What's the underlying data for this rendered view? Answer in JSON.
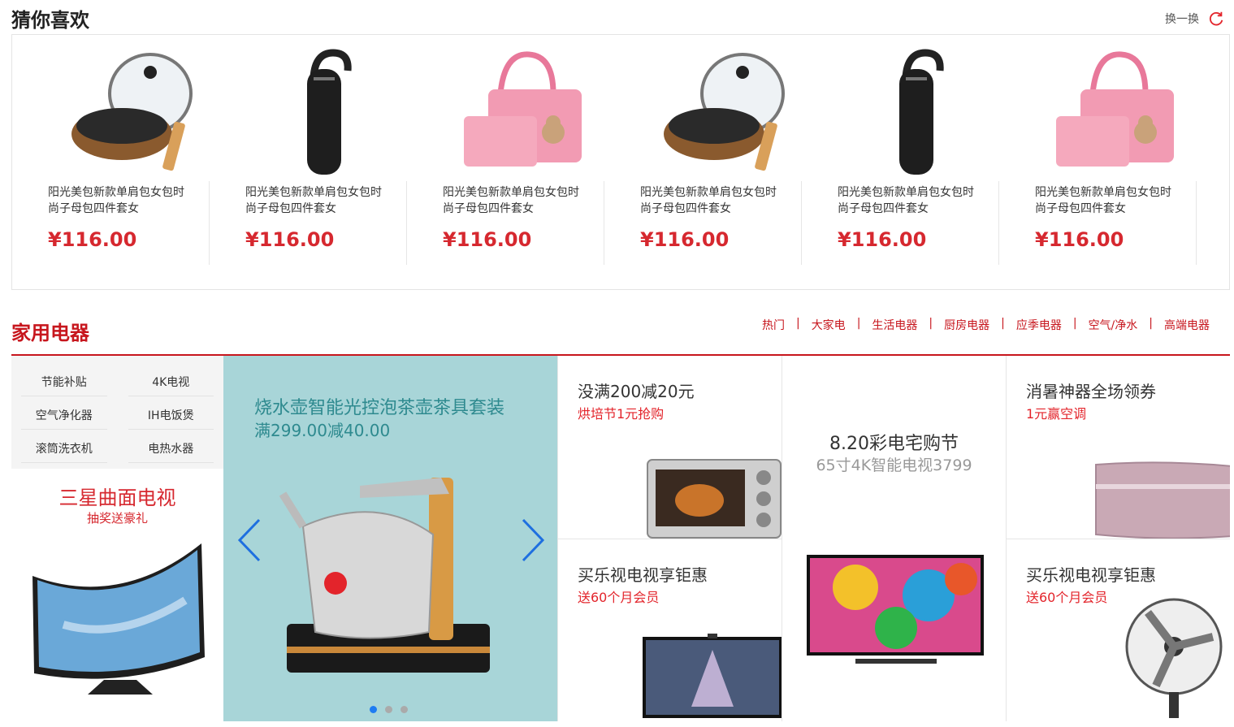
{
  "guess": {
    "title": "猜你喜欢",
    "refresh_label": "换一换",
    "items": [
      {
        "image": "frying-pan",
        "name": "阳光美包新款单肩包女包时尚子母包四件套女",
        "price": "¥116.00"
      },
      {
        "image": "bluetooth-earpiece",
        "name": "阳光美包新款单肩包女包时尚子母包四件套女",
        "price": "¥116.00"
      },
      {
        "image": "pink-handbag-set",
        "name": "阳光美包新款单肩包女包时尚子母包四件套女",
        "price": "¥116.00"
      },
      {
        "image": "frying-pan",
        "name": "阳光美包新款单肩包女包时尚子母包四件套女",
        "price": "¥116.00"
      },
      {
        "image": "bluetooth-earpiece",
        "name": "阳光美包新款单肩包女包时尚子母包四件套女",
        "price": "¥116.00"
      },
      {
        "image": "pink-handbag-set",
        "name": "阳光美包新款单肩包女包时尚子母包四件套女",
        "price": "¥116.00"
      }
    ]
  },
  "appliances": {
    "title": "家用电器",
    "nav": [
      "热门",
      "大家电",
      "生活电器",
      "厨房电器",
      "应季电器",
      "空气/净水",
      "高端电器"
    ],
    "nav_separator": "|",
    "categories": [
      "节能补贴",
      "4K电视",
      "空气净化器",
      "IH电饭煲",
      "滚筒洗衣机",
      "电热水器"
    ],
    "left_promo": {
      "title": "三星曲面电视",
      "subtitle": "抽奖送豪礼"
    },
    "carousel": {
      "title": "烧水壶智能光控泡茶壶茶具套装",
      "subtitle": "满299.00减40.00",
      "slides": 3,
      "active_slide": 1
    },
    "tiles": {
      "oven": {
        "title": "没满200减20元",
        "subtitle": "烘培节1元抢购"
      },
      "center": {
        "title": "8.20彩电宅购节",
        "subtitle": "65寸4K智能电视3799"
      },
      "aircon": {
        "title": "消暑神器全场领券",
        "subtitle": "1元赢空调"
      },
      "tv": {
        "title": "买乐视电视享钜惠",
        "subtitle": "送60个月会员"
      },
      "fan": {
        "title": "买乐视电视享钜惠",
        "subtitle": "送60个月会员"
      }
    }
  },
  "colors": {
    "accent_red": "#c7161d",
    "price_red": "#d6282f",
    "carousel_bg": "#a8d5d8",
    "carousel_text": "#2e8a8f",
    "dot_active": "#1e7cf2"
  }
}
